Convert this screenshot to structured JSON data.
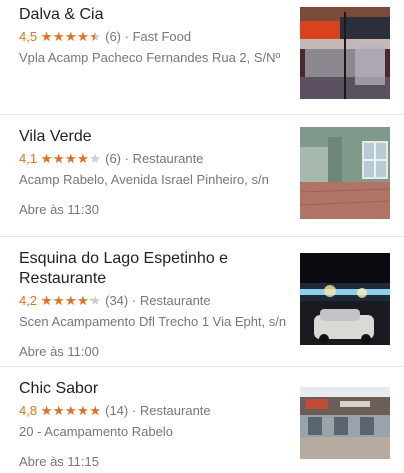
{
  "places": [
    {
      "name": "Dalva & Cia",
      "rating": "4,5",
      "rating_value": 4.5,
      "reviews": "(6)",
      "category": "Fast Food",
      "address": "Vpla Acamp Pacheco Fernandes Rua 2, S/Nº",
      "hours": ""
    },
    {
      "name": "Vila Verde",
      "rating": "4,1",
      "rating_value": 4.1,
      "reviews": "(6)",
      "category": "Restaurante",
      "address": "Acamp Rabelo, Avenida Israel Pinheiro, s/n",
      "hours": "Abre às 11:30"
    },
    {
      "name": "Esquina do Lago Espetinho e Restaurante",
      "rating": "4,2",
      "rating_value": 4.2,
      "reviews": "(34)",
      "category": "Restaurante",
      "address": "Scen Acampamento Dfl Trecho 1 Via Epht, s/n",
      "hours": "Abre às 11:00"
    },
    {
      "name": "Chic Sabor",
      "rating": "4,8",
      "rating_value": 4.8,
      "reviews": "(14)",
      "category": "Restaurante",
      "address": "20 - Acampamento Rabelo",
      "hours": "Abre às 11:15"
    }
  ],
  "separator": "·",
  "star_glyphs": "★★★★★",
  "colors": {
    "star": "#e7711b",
    "text": "#222222",
    "muted": "#777777",
    "divider": "#e5e5e5"
  }
}
